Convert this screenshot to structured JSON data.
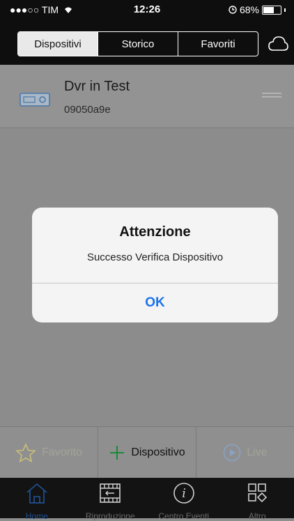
{
  "status_bar": {
    "carrier": "●●●○○ TIM",
    "time": "12:26",
    "battery": "68%",
    "battery_level": 0.68
  },
  "segments": [
    {
      "label": "Dispositivi",
      "selected": true
    },
    {
      "label": "Storico",
      "selected": false
    },
    {
      "label": "Favoriti",
      "selected": false
    }
  ],
  "device": {
    "name": "Dvr in Test",
    "id": "09050a9e",
    "icon": "dvr-icon"
  },
  "alert": {
    "title": "Attenzione",
    "message": "Successo Verifica Dispositivo",
    "ok_label": "OK"
  },
  "actions": {
    "favorite_label": "Favorito",
    "add_label": "Dispositivo",
    "live_label": "Live"
  },
  "tabs": [
    {
      "label": "Home",
      "icon": "home-icon",
      "active": true
    },
    {
      "label": "Riproduzione",
      "icon": "film-icon",
      "active": false
    },
    {
      "label": "Centro Eventi",
      "icon": "info-icon",
      "active": false
    },
    {
      "label": "Altro",
      "icon": "grid-icon",
      "active": false
    }
  ],
  "colors": {
    "accent": "#1a73e8",
    "tab_active": "#1f4f8f",
    "topbar": "#0e0e0e"
  }
}
